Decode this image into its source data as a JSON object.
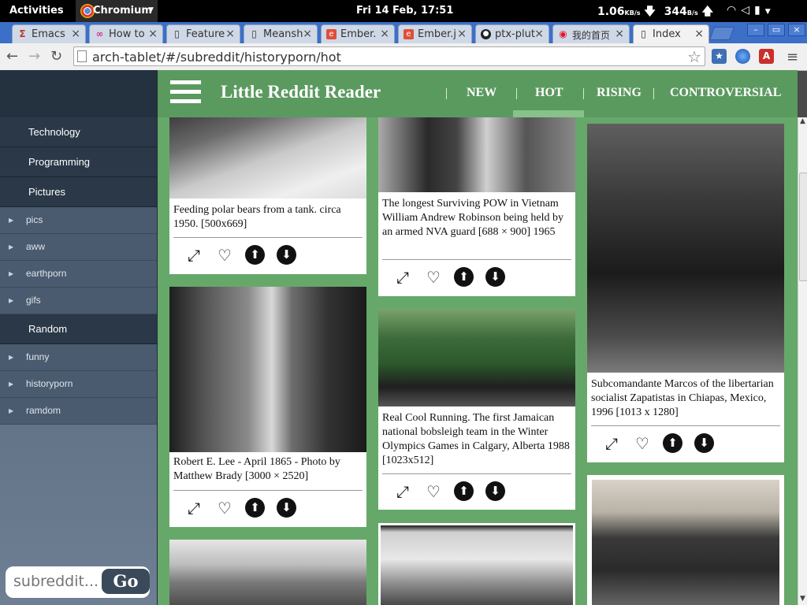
{
  "system_bar": {
    "activities": "Activities",
    "app_name": "Chromium",
    "clock": "Fri 14 Feb, 17:51",
    "net_down": "1.06",
    "net_down_unit": "KB/s",
    "net_up": "344",
    "net_up_unit": "B/s"
  },
  "tabs": [
    {
      "title": "Emacs",
      "icon": "emacs-icon"
    },
    {
      "title": "How to",
      "icon": "page-icon"
    },
    {
      "title": "Feature",
      "icon": "page-icon"
    },
    {
      "title": "Meansh",
      "icon": "page-icon"
    },
    {
      "title": "Ember.",
      "icon": "ember-icon"
    },
    {
      "title": "Ember.j",
      "icon": "ember-icon"
    },
    {
      "title": "ptx-plut",
      "icon": "github-icon"
    },
    {
      "title": "我的首页",
      "icon": "weibo-icon"
    },
    {
      "title": "Index",
      "icon": "page-icon",
      "active": true
    }
  ],
  "address_bar": {
    "url": "arch-tablet/#/subreddit/historyporn/hot"
  },
  "sidebar": {
    "sections": [
      {
        "label": "Technology"
      },
      {
        "label": "Programming"
      },
      {
        "label": "Pictures"
      }
    ],
    "pictures_items": [
      "pics",
      "aww",
      "earthporn",
      "gifs"
    ],
    "random_label": "Random",
    "random_items": [
      "funny",
      "historyporn",
      "ramdom"
    ],
    "search_placeholder": "subreddit...",
    "go_label": "Go"
  },
  "header": {
    "brand": "Little Reddit Reader",
    "nav": [
      "NEW",
      "HOT",
      "RISING",
      "CONTROVERSIAL"
    ],
    "active_nav": "HOT"
  },
  "posts": {
    "polar_bears": "Feeding polar bears from a tank. circa 1950. [500x669]",
    "pow": "The longest Surviving POW in Vietnam William Andrew Robinson being held by an armed NVA guard [688 × 900] 1965",
    "marcos": "Subcomandante Marcos of the libertarian socialist Zapatistas in Chiapas, Mexico, 1996 [1013 x 1280]",
    "lee": "Robert E. Lee - April 1865 - Photo by Matthew Brady [3000 × 2520]",
    "running": "Real Cool Running. The first Jamaican national bobsleigh team in the Winter Olympics Games in Calgary, Alberta 1988 [1023x512]"
  },
  "colors": {
    "header_green": "#5b9a5f",
    "content_green": "#66a86a",
    "sidebar_dark": "#2a3847",
    "tab_strip_blue": "#3c6fc8"
  }
}
